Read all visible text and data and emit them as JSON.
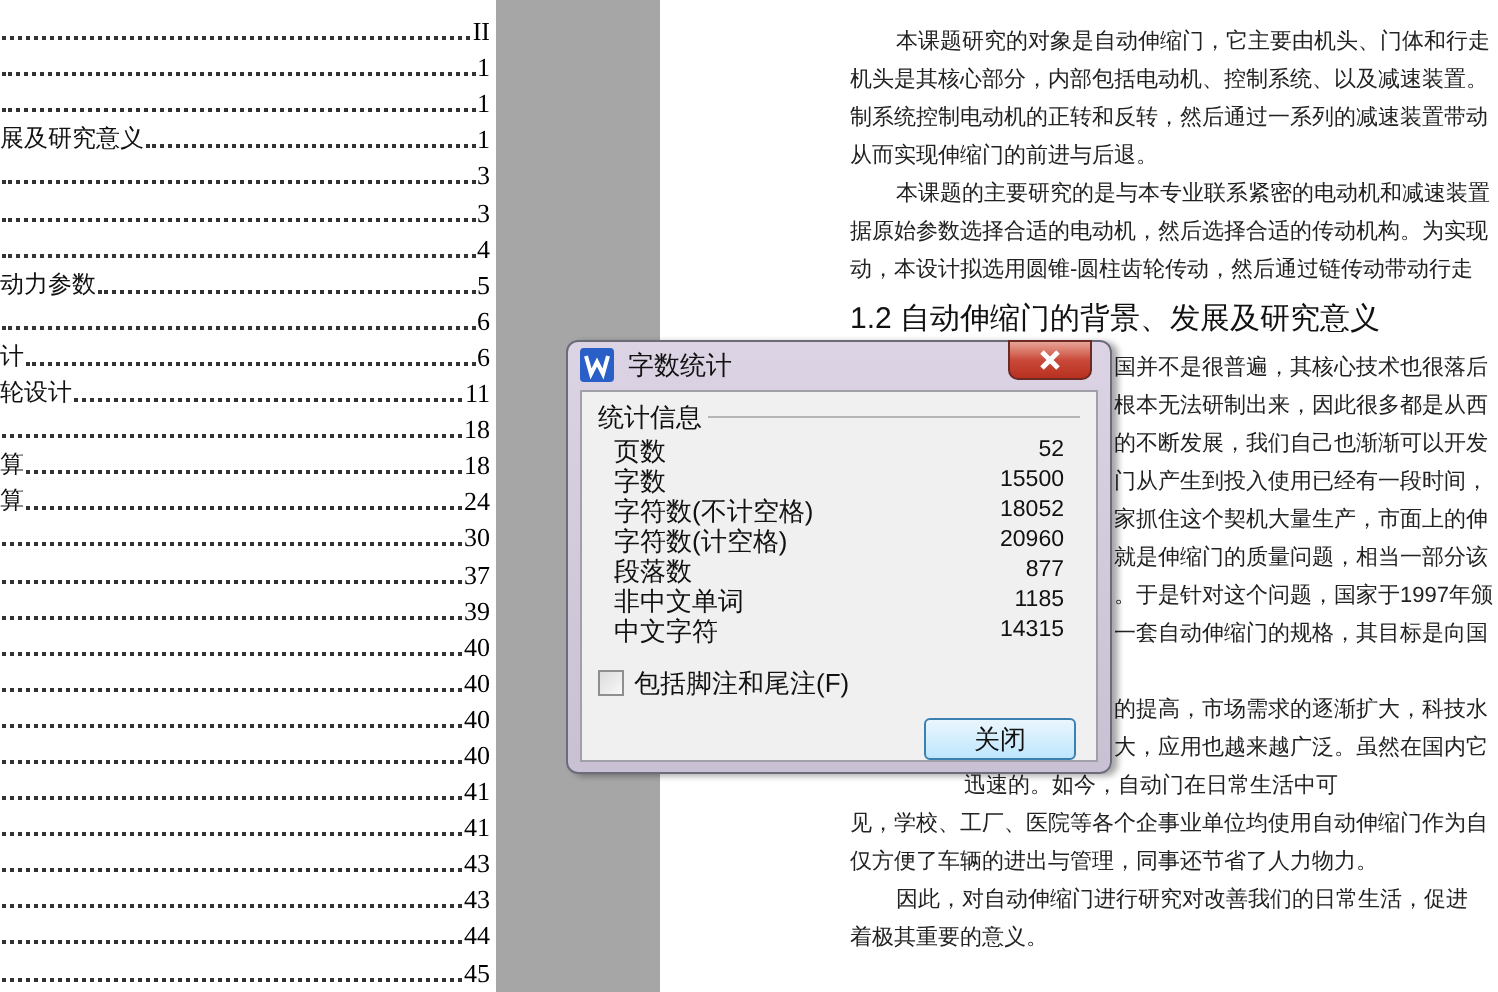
{
  "toc": [
    {
      "page": "II"
    },
    {
      "page": "1"
    },
    {
      "page": "1"
    },
    {
      "title": "展及研究意义",
      "page": "1"
    },
    {
      "page": "3"
    },
    {
      "page": "3"
    },
    {
      "page": "4"
    },
    {
      "title": "动力参数",
      "page": "5"
    },
    {
      "page": "6"
    },
    {
      "title": "计",
      "page": "6"
    },
    {
      "title": "轮设计",
      "page": "11"
    },
    {
      "page": "18"
    },
    {
      "title": "算",
      "page": "18"
    },
    {
      "title": "算",
      "page": "24"
    },
    {
      "page": "30"
    },
    {
      "page": "37"
    },
    {
      "page": "39"
    },
    {
      "page": "40"
    },
    {
      "page": "40"
    },
    {
      "page": "40"
    },
    {
      "page": "40"
    },
    {
      "page": "41"
    },
    {
      "page": "41"
    },
    {
      "page": "43"
    },
    {
      "page": "43"
    },
    {
      "page": "44"
    },
    {
      "page": "45"
    }
  ],
  "document": [
    {
      "kind": "indent",
      "text": "本课题研究的对象是自动伸缩门，它主要由机头、门体和行走"
    },
    {
      "kind": "line",
      "text": "机头是其核心部分，内部包括电动机、控制系统、以及减速装置。"
    },
    {
      "kind": "line",
      "text": "制系统控制电动机的正转和反转，然后通过一系列的减速装置带动"
    },
    {
      "kind": "line",
      "text": "从而实现伸缩门的前进与后退。"
    },
    {
      "kind": "indent",
      "text": "本课题的主要研究的是与本专业联系紧密的电动机和减速装置"
    },
    {
      "kind": "line",
      "text": "据原始参数选择合适的电动机，然后选择合适的传动机构。为实现"
    },
    {
      "kind": "line",
      "text": "动，本设计拟选用圆锥-圆柱齿轮传动，然后通过链传动带动行走"
    },
    {
      "kind": "heading",
      "text": "1.2 自动伸缩门的背景、发展及研究意义"
    },
    {
      "kind": "covered",
      "text": "国并不是很普遍，其核心技术也很落后"
    },
    {
      "kind": "covered",
      "text": "根本无法研制出来，因此很多都是从西"
    },
    {
      "kind": "covered",
      "text": "的不断发展，我们自己也渐渐可以开发"
    },
    {
      "kind": "covered",
      "text": "门从产生到投入使用已经有一段时间，"
    },
    {
      "kind": "covered",
      "text": "家抓住这个契机大量生产，市面上的伸"
    },
    {
      "kind": "covered",
      "text": "就是伸缩门的质量问题，相当一部分该"
    },
    {
      "kind": "covered",
      "text": "。于是针对这个问题，国家于1997年颁"
    },
    {
      "kind": "covered",
      "text": "一套自动伸缩门的规格，其目标是向国"
    },
    {
      "kind": "gap"
    },
    {
      "kind": "covered",
      "text": "的提高，市场需求的逐渐扩大，科技水"
    },
    {
      "kind": "covered",
      "text": "大，应用也越来越广泛。虽然在国内它"
    },
    {
      "kind": "shadowed",
      "text": "迅速的。如今，自动门在日常生活中可"
    },
    {
      "kind": "line",
      "text": "见，学校、工厂、医院等各个企事业单位均使用自动伸缩门作为自"
    },
    {
      "kind": "line",
      "text": "仅方便了车辆的进出与管理，同事还节省了人力物力。"
    },
    {
      "kind": "indent",
      "text": "因此，对自动伸缩门进行研究对改善我们的日常生活，促进"
    },
    {
      "kind": "line",
      "text": "着极其重要的意义。"
    }
  ],
  "dialog": {
    "title": "字数统计",
    "group": "统计信息",
    "stats": [
      {
        "label": "页数",
        "value": "52"
      },
      {
        "label": "字数",
        "value": "15500"
      },
      {
        "label": "字符数(不计空格)",
        "value": "18052"
      },
      {
        "label": "字符数(计空格)",
        "value": "20960"
      },
      {
        "label": "段落数",
        "value": "877"
      },
      {
        "label": "非中文单词",
        "value": "1185"
      },
      {
        "label": "中文字符",
        "value": "14315"
      }
    ],
    "checkbox": {
      "label": "包括脚注和尾注(F)",
      "checked": false
    },
    "button": "关闭"
  }
}
